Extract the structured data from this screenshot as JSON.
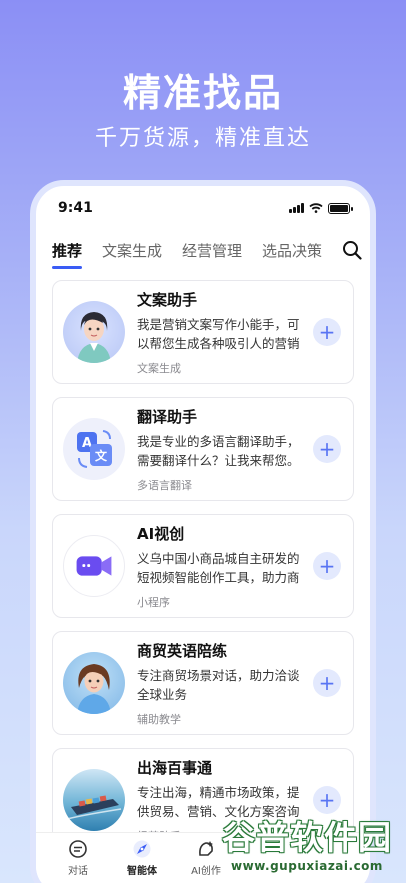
{
  "hero": {
    "title": "精准找品",
    "subtitle": "千万货源，精准直达"
  },
  "status": {
    "time": "9:41"
  },
  "tabs": [
    {
      "label": "推荐",
      "active": true
    },
    {
      "label": "文案生成",
      "active": false
    },
    {
      "label": "经营管理",
      "active": false
    },
    {
      "label": "选品决策",
      "active": false
    }
  ],
  "cards": [
    {
      "title": "文案助手",
      "desc": "我是营销文案写作小能手，可以帮您生成各种吸引人的营销文案",
      "tag": "文案生成",
      "add": "+"
    },
    {
      "title": "翻译助手",
      "desc": "我是专业的多语言翻译助手，需要翻译什么？让我来帮您。",
      "tag": "多语言翻译",
      "add": "+"
    },
    {
      "title": "AI视创",
      "desc": "义乌中国小商品城自主研发的短视频智能创作工具，助力商家",
      "tag": "小程序",
      "add": "+"
    },
    {
      "title": "商贸英语陪练",
      "desc": "专注商贸场景对话，助力洽谈全球业务",
      "tag": "辅助教学",
      "add": "+"
    },
    {
      "title": "出海百事通",
      "desc": "专注出海，精通市场政策，提供贸易、营销、文化方案咨询",
      "tag": "经营助手",
      "add": "+"
    }
  ],
  "nav": [
    {
      "label": "对话",
      "icon": "chat-icon"
    },
    {
      "label": "智能体",
      "icon": "compass-icon",
      "active": true
    },
    {
      "label": "AI创作",
      "icon": "ai-create-icon"
    }
  ],
  "watermark": {
    "main": "谷普软件园",
    "url": "www.gupuxiazai.com"
  },
  "colors": {
    "accent": "#3a5cf5",
    "add_bg": "#e3e9fd"
  }
}
